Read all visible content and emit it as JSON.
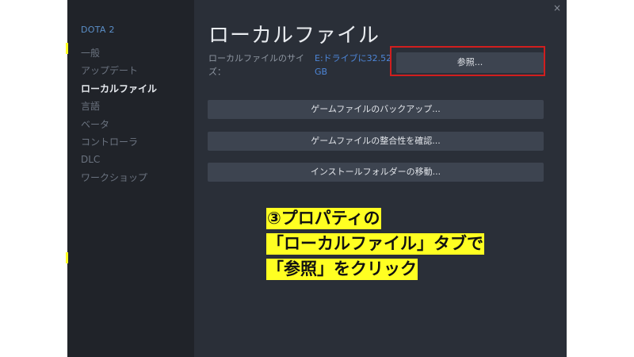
{
  "sidebar": {
    "game_title": "DOTA 2",
    "items": [
      {
        "label": "一般"
      },
      {
        "label": "アップデート"
      },
      {
        "label": "ローカルファイル"
      },
      {
        "label": "言語"
      },
      {
        "label": "ベータ"
      },
      {
        "label": "コントローラ"
      },
      {
        "label": "DLC"
      },
      {
        "label": "ワークショップ"
      }
    ]
  },
  "window": {
    "close_glyph": "×"
  },
  "main": {
    "heading": "ローカルファイル",
    "size_label": "ローカルファイルのサイズ：",
    "size_value": "E:ドライブに32.52 GB",
    "browse_label": "参照...",
    "buttons": [
      {
        "label": "ゲームファイルのバックアップ..."
      },
      {
        "label": "ゲームファイルの整合性を確認..."
      },
      {
        "label": "インストールフォルダーの移動..."
      }
    ]
  },
  "annotation": {
    "lines": [
      "③プロパティの",
      "「ローカルファイル」タブで",
      "「参照」をクリック"
    ],
    "highlight_color": "#ffff22",
    "box_color": "#d11e1e"
  }
}
